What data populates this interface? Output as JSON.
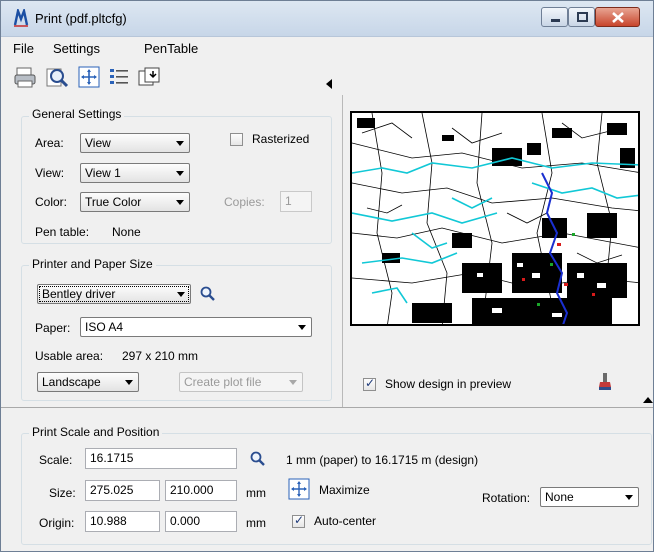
{
  "window": {
    "title": "Print (pdf.pltcfg)",
    "accent": "#c8452c"
  },
  "menu": {
    "file": "File",
    "settings": "Settings",
    "pentable": "PenTable"
  },
  "toolbar": {
    "icons": [
      "printer-icon",
      "preview-magnifier-icon",
      "fit-area-icon",
      "list-icon",
      "window-select-icon"
    ]
  },
  "general": {
    "title": "General Settings",
    "area_label": "Area:",
    "area_value": "View",
    "view_label": "View:",
    "view_value": "View 1",
    "color_label": "Color:",
    "color_value": "True Color",
    "rasterized_label": "Rasterized",
    "copies_label": "Copies:",
    "copies_value": "1",
    "pentable_label": "Pen table:",
    "pentable_value": "None"
  },
  "printer": {
    "title": "Printer and Paper Size",
    "driver_value": "Bentley driver",
    "paper_label": "Paper:",
    "paper_value": "ISO A4",
    "usable_label": "Usable area:",
    "usable_value": "297 x 210 mm",
    "orientation_value": "Landscape",
    "plotfile_value": "Create plot file"
  },
  "preview": {
    "show_design_label": "Show design in preview",
    "show_design_checked": true
  },
  "scale": {
    "title": "Print Scale and Position",
    "scale_label": "Scale:",
    "scale_value": "16.1715",
    "scale_ratio_text": "1 mm (paper) to 16.1715 m (design)",
    "size_label": "Size:",
    "size_x": "275.025",
    "size_y": "210.000",
    "size_unit": "mm",
    "maximize_label": "Maximize",
    "origin_label": "Origin:",
    "origin_x": "10.988",
    "origin_y": "0.000",
    "origin_unit": "mm",
    "autocenter_label": "Auto-center",
    "autocenter_checked": true,
    "rotation_label": "Rotation:",
    "rotation_value": "None"
  }
}
